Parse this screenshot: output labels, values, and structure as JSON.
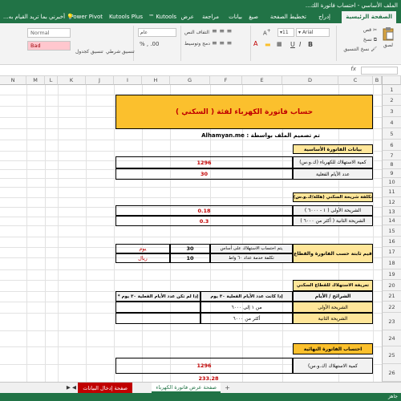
{
  "window": {
    "title": "الملف الأساسي - احتساب فاتورة الك..."
  },
  "ribbon": {
    "tabs": [
      "الصفحة الرئيسية",
      "إدراج",
      "تخطيط الصفحة",
      "صيغ",
      "بيانات",
      "مراجعة",
      "عرض",
      "Kutools ™",
      "Kutools Plus",
      "Power Pivot"
    ],
    "tell_me": "أخبرني بما تريد القيام به...",
    "clipboard": {
      "paste": "لصق",
      "cut": "قص",
      "copy": "نسخ",
      "format_painter": "نسخ التنسيق"
    },
    "font": {
      "name": "Arial",
      "size": "11"
    },
    "alignment": {
      "wrap": "التفاف النص",
      "merge": "دمج وتوسيط"
    },
    "number": {
      "format": "عام"
    },
    "styles": {
      "conditional": "تنسيق شرطي",
      "table": "تنسيق كجدول",
      "normal": "Normal",
      "bad": "Bad"
    }
  },
  "grid": {
    "columns": [
      "B",
      "C",
      "D",
      "E",
      "F",
      "G",
      "H",
      "I",
      "J",
      "K",
      "L",
      "M",
      "N"
    ],
    "rows": [
      "1",
      "2",
      "3",
      "4",
      "5",
      "6",
      "7",
      "8",
      "9",
      "10",
      "11",
      "12",
      "13",
      "14",
      "15",
      "16",
      "17",
      "18",
      "19",
      "20",
      "21",
      "22",
      "23",
      "24",
      "25",
      "26"
    ]
  },
  "sheet": {
    "title": "حساب فاتورة الكهرباء لفئة ( السكني )",
    "designer_label": "تم تصميم الملف بواسطة : Alhamyan.me",
    "basic_header": "بيانات الفاتورة الأساسية",
    "consumption_label": "كمية الاستهلاك للكهرباء (ك.و.س)",
    "consumption_value": "1296",
    "days_label": "عدد الأيام الفعلية",
    "days_value": "30",
    "tier_header": "تكلفة شريحة السكني (هللة/ك.و.س)",
    "tier1_label": "الشريحة الأولى ( ١ - ٦٠٠٠ )",
    "tier1_value": "0.18",
    "tier2_label": "الشريحة الثانية ( أكثر من ٦٠٠٠ )",
    "tier2_value": "0.3",
    "fixed_header": "قيم ثابتة حسب الفاتورة والقطاع",
    "calc_basis_label": "يتم احتساب الاستهلاك على أساس",
    "calc_basis_value": "30",
    "calc_basis_unit": "يوم",
    "service_fee_label": "تكلفة خدمة عداد ٦٠ واط",
    "service_fee_value": "10",
    "service_fee_unit": "ريال",
    "tariff_header": "تعريفة الاستهلاك للقطاع السكني",
    "tariff_col_tiers": "الشرائح / الأيام",
    "tariff_col_30": "إذا كانت عدد الأيام الفعلية ٣٠ يوم",
    "tariff_col_not30": "إذا لم تكن عدد الأيام الفعلية ٣٠ يوم *",
    "tariff_row1": "الشريحة الأولى",
    "tariff_row1_range": "من ١ إلى ٦٠٠٠",
    "tariff_row2": "الشريحة الثانية",
    "tariff_row2_range": "أكثر من ٦٠٠٠",
    "final_header": "احتساب الفاتورة النهائية",
    "final_consumption_label": "كمية الاستهلاك (ك.و.س)",
    "final_consumption_value": "1296",
    "partial_value": "233.28"
  },
  "sheet_tabs": {
    "tabs": [
      "صفحة إدخال البيانات",
      "صفحة عرض فاتورة الكهرباء"
    ],
    "add_label": "+"
  },
  "status_bar": {
    "ready": "جاهز"
  },
  "colors": {
    "excel_green": "#217346",
    "header_gold": "#fbc02d",
    "header_light": "#ffe699",
    "value_red": "#c00000"
  }
}
